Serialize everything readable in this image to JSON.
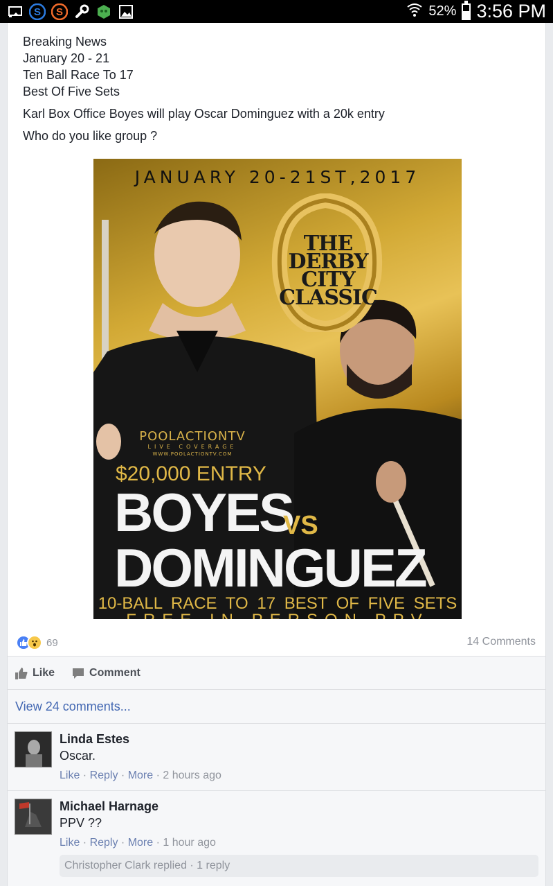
{
  "status_bar": {
    "battery_percent": "52%",
    "battery_level": 0.52,
    "time": "3:56 PM",
    "icons": [
      "cast-icon",
      "s-app-icon-blue",
      "s-app-icon-orange",
      "wrench-icon",
      "game-app-icon",
      "image-icon",
      "wifi-icon",
      "battery-icon"
    ]
  },
  "post": {
    "lines": [
      "Breaking News",
      "January 20 - 21",
      "Ten Ball Race To 17",
      "Best Of Five Sets"
    ],
    "para1": "Karl Box Office Boyes will play Oscar Dominguez with a 20k entry",
    "para2": "Who do you like group ?"
  },
  "poster": {
    "date": "JANUARY 20-21ST,2017",
    "derby_line1": "THE",
    "derby_line2": "DERBY CITY",
    "derby_line3": "CLASSIC",
    "patv_name": "POOLACTIONTV",
    "patv_sub": "LIVE COVERAGE",
    "patv_url": "WWW.POOLACTIONTV.COM",
    "entry": "$20,000 ENTRY",
    "player1": "BOYES",
    "vs": "VS",
    "player2": "DOMINGUEZ",
    "race": "10-BALL  RACE TO 17  BEST OF FIVE SETS",
    "free": "FREE IN PERSON PPV ONLINE"
  },
  "reactions": {
    "count": "69",
    "comments": "14 Comments"
  },
  "actions": {
    "like": "Like",
    "comment": "Comment"
  },
  "view_more": "View 24 comments...",
  "comments": [
    {
      "name": "Linda Estes",
      "text": "Oscar.",
      "like": "Like",
      "reply": "Reply",
      "more": "More",
      "time": "2 hours ago"
    },
    {
      "name": "Michael Harnage",
      "text": "PPV ??",
      "like": "Like",
      "reply": "Reply",
      "more": "More",
      "time": "1 hour ago",
      "replies": "Christopher Clark replied · 1 reply"
    }
  ],
  "colors": {
    "link": "#4267b2",
    "meta": "#90949c",
    "text": "#1d2129",
    "like_reaction": "#4a80f5",
    "wow_reaction": "#f7c84a",
    "poster_gold": "#e0b847"
  }
}
